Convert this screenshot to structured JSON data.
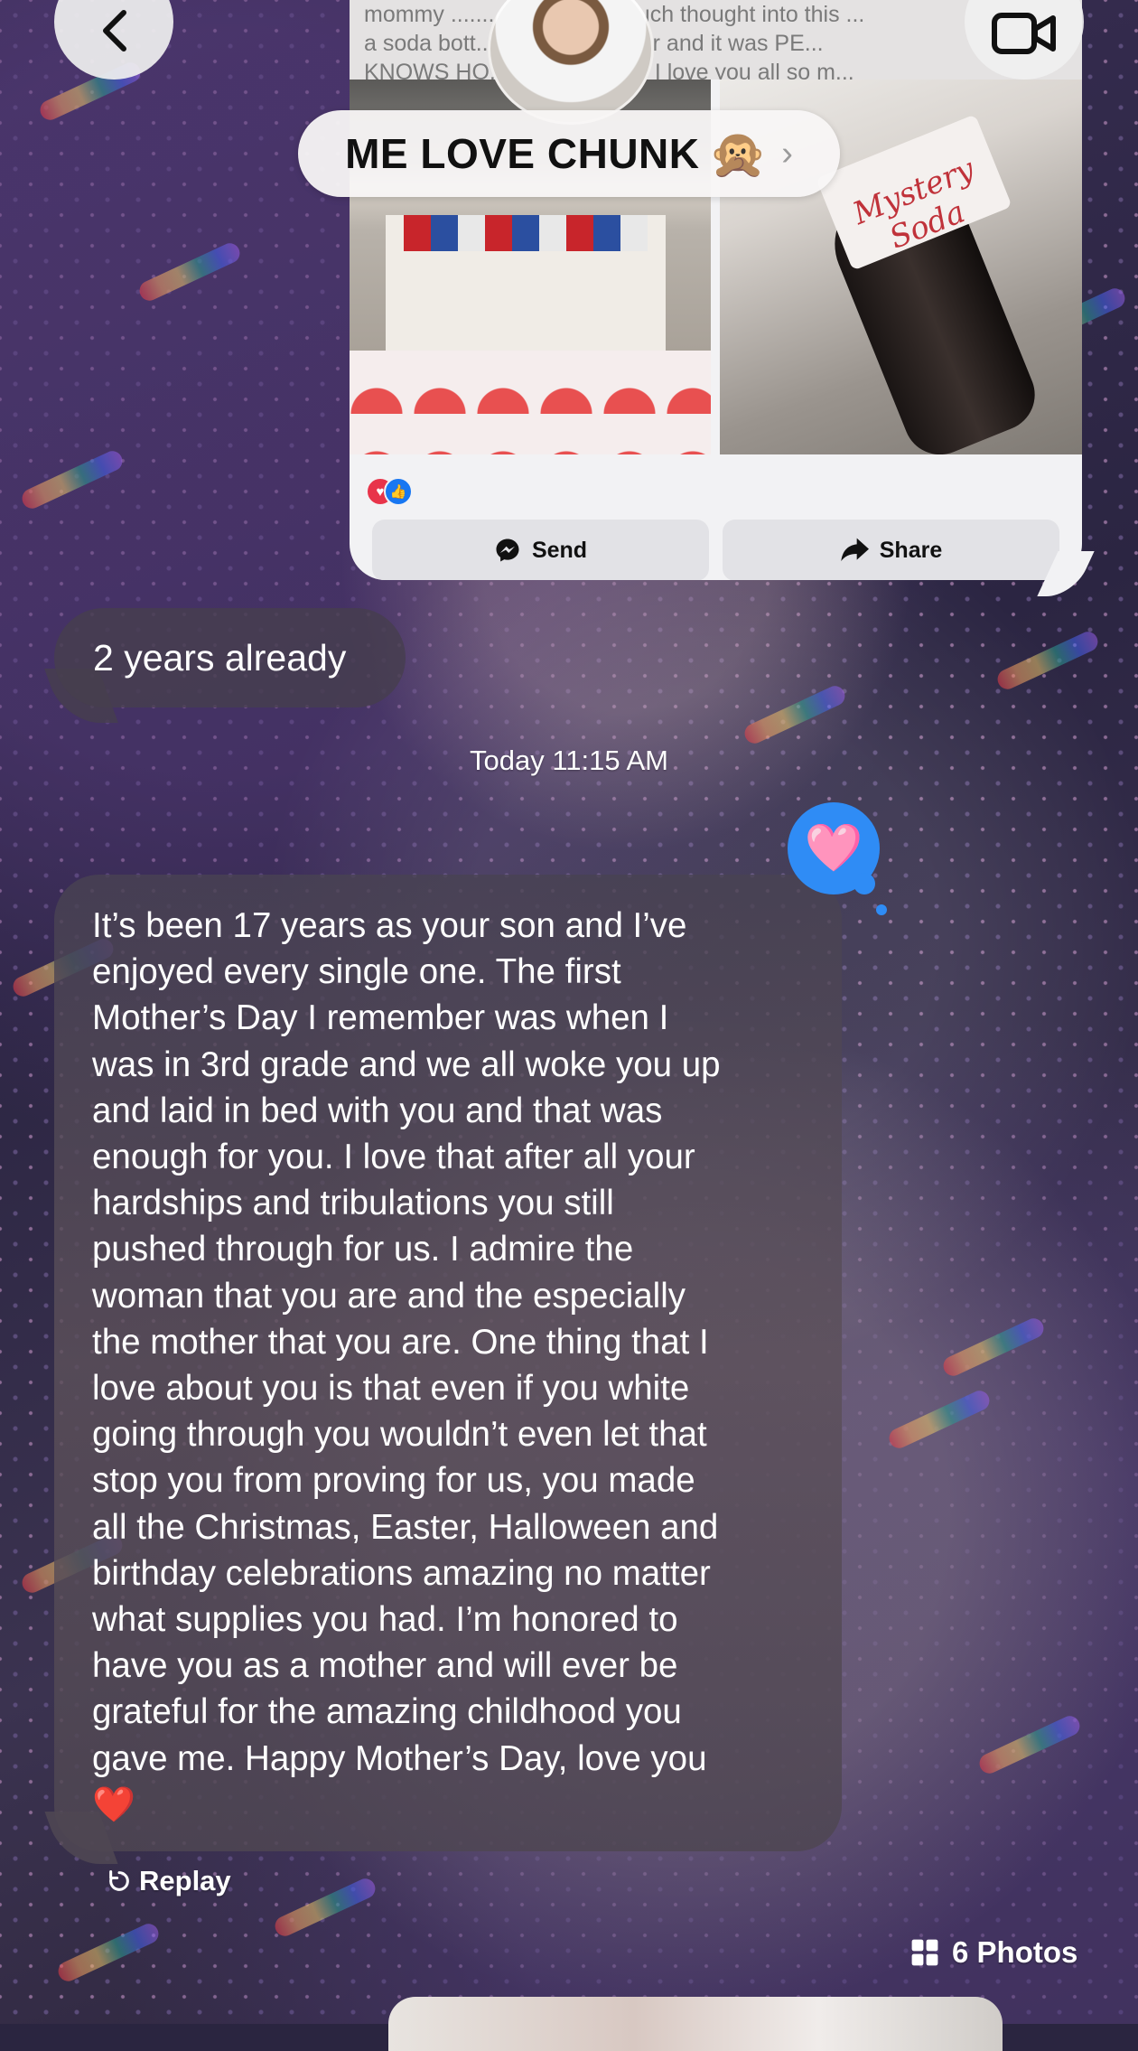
{
  "header": {
    "contact_name": "ME LOVE CHUNK",
    "contact_emoji": "🙊",
    "chevron": "›",
    "back_icon": "chevron-left-icon",
    "video_icon": "video-camera-icon"
  },
  "link_card": {
    "text_lines": [
      "mommy ..................... so much thought into this ...",
      "a soda bott... guess the flavor and it was PE...",
      "KNOWS HO... E MY PEPS!! I love you all so m..."
    ],
    "photo_right_label": "Mystery Soda",
    "reactions": [
      "heart-reaction-icon",
      "like-reaction-icon"
    ],
    "send_label": "Send",
    "share_label": "Share"
  },
  "messages": {
    "first": "2 years already",
    "timestamp": "Today 11:15 AM",
    "second_lines": [
      "It’s been 17 years as your son and I’ve",
      "enjoyed every single one. The first",
      "Mother’s Day I remember was when I",
      "was in 3rd grade and we all woke you up",
      "and laid in bed with you and that was",
      "enough for you. I love that after all your",
      "hardships and tribulations you still",
      "pushed through for us. I admire the",
      "woman that you are and the especially",
      "the mother that you are. One thing that I",
      "love about you is that even if you white",
      "going through you wouldn’t even let that",
      "stop you from proving for us, you made",
      "all the Christmas, Easter, Halloween and",
      "birthday celebrations amazing no matter",
      "what supplies you had. I’m honored  to",
      "have you as a mother and will ever be",
      "grateful for the amazing childhood you",
      "gave me. Happy Mother’s Day, love you",
      "❤️"
    ],
    "tapback": "🩷",
    "replay_label": "Replay",
    "photos_label": "6 Photos"
  },
  "colors": {
    "bubble": "#463e4e",
    "tapback": "#2f8cf5",
    "card": "#f2f2f4"
  }
}
